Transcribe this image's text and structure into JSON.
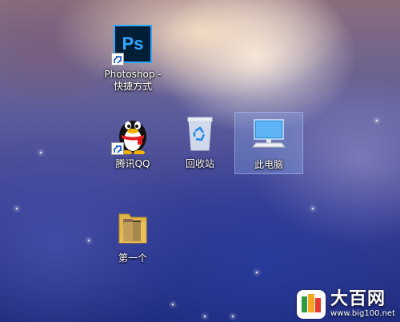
{
  "desktop": {
    "icons": [
      {
        "label_line1": "Photoshop -",
        "label_line2": "快捷方式",
        "icon": "photoshop-icon",
        "ps_text": "Ps"
      },
      {
        "label": "腾讯QQ",
        "icon": "qq-penguin-icon"
      },
      {
        "label": "回收站",
        "icon": "recycle-bin-icon"
      },
      {
        "label": "此电脑",
        "icon": "computer-monitor-icon"
      },
      {
        "label": "第一个",
        "icon": "folder-icon"
      }
    ]
  },
  "watermark": {
    "title": "大百网",
    "url": "www.big100.net"
  }
}
